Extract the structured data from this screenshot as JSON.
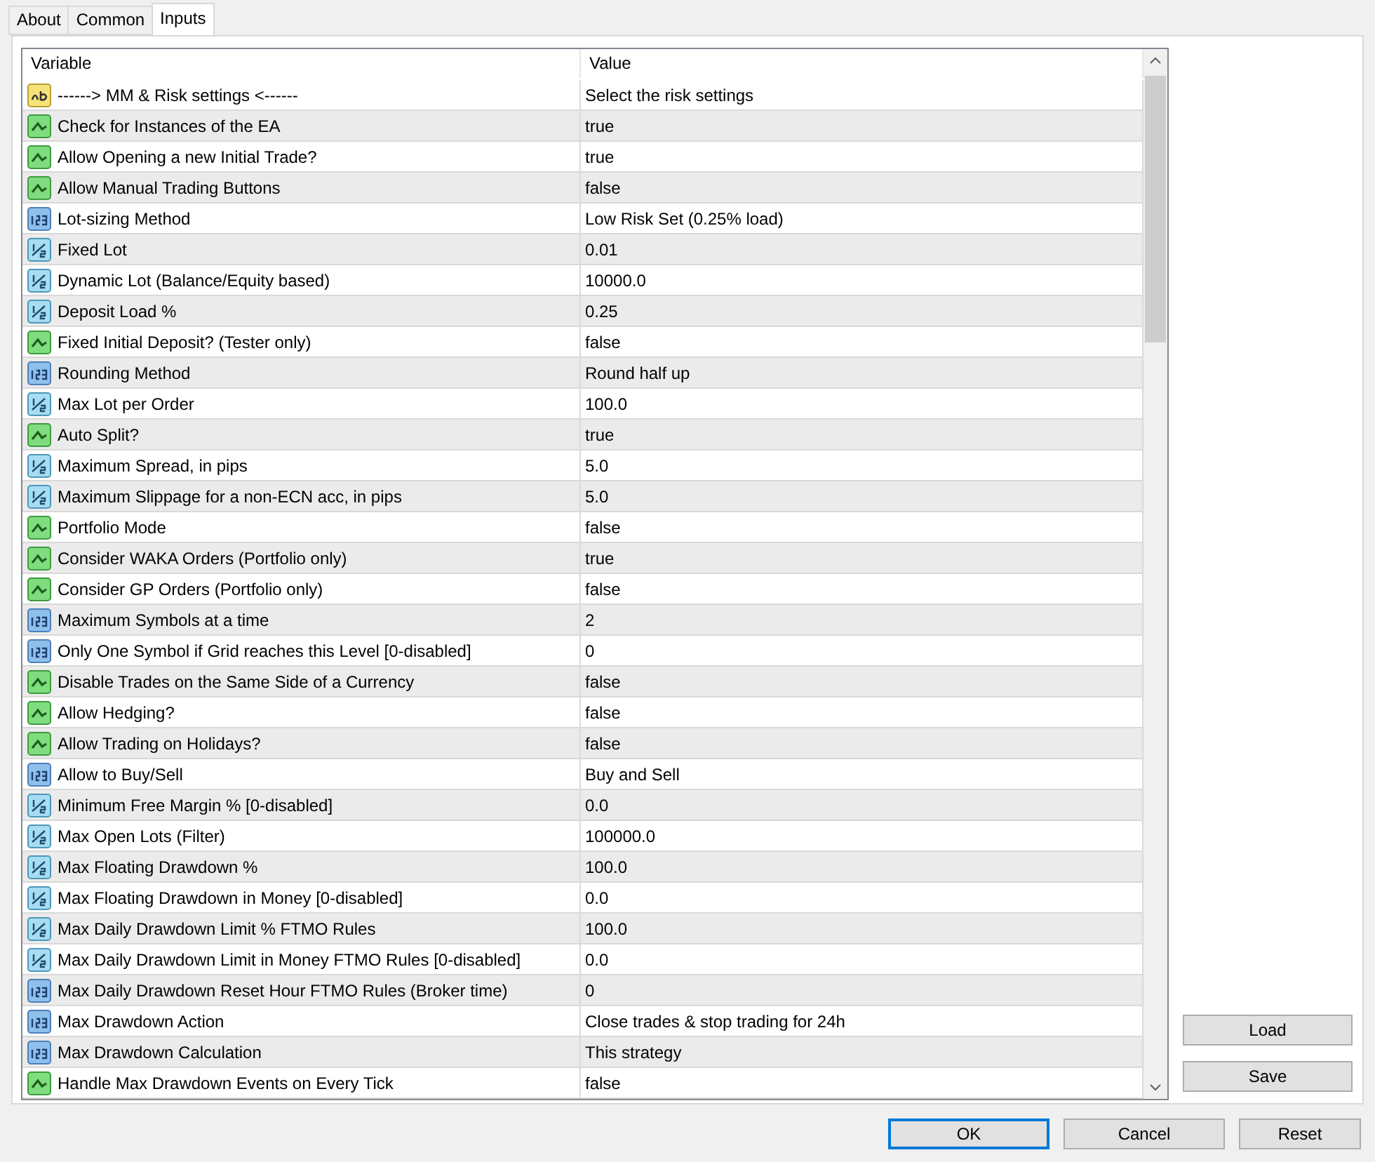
{
  "tabs": [
    {
      "label": "About",
      "selected": false
    },
    {
      "label": "Common",
      "selected": false
    },
    {
      "label": "Inputs",
      "selected": true
    }
  ],
  "table": {
    "columns": [
      "Variable",
      "Value"
    ],
    "rows": [
      {
        "kind": "string",
        "variable": "------> MM & Risk settings <------",
        "value": "Select the risk settings"
      },
      {
        "kind": "bool",
        "variable": "Check for Instances of the EA",
        "value": "true"
      },
      {
        "kind": "bool",
        "variable": "Allow Opening a new Initial Trade?",
        "value": "true"
      },
      {
        "kind": "bool",
        "variable": "Allow Manual Trading Buttons",
        "value": "false"
      },
      {
        "kind": "int",
        "variable": "Lot-sizing Method",
        "value": "Low Risk Set (0.25% load)"
      },
      {
        "kind": "double",
        "variable": "Fixed Lot",
        "value": "0.01"
      },
      {
        "kind": "double",
        "variable": "Dynamic Lot (Balance/Equity based)",
        "value": "10000.0"
      },
      {
        "kind": "double",
        "variable": "Deposit Load %",
        "value": "0.25"
      },
      {
        "kind": "bool",
        "variable": "Fixed Initial Deposit? (Tester only)",
        "value": "false"
      },
      {
        "kind": "int",
        "variable": "Rounding Method",
        "value": "Round half up"
      },
      {
        "kind": "double",
        "variable": "Max Lot per Order",
        "value": "100.0"
      },
      {
        "kind": "bool",
        "variable": "Auto Split?",
        "value": "true"
      },
      {
        "kind": "double",
        "variable": "Maximum Spread, in pips",
        "value": "5.0"
      },
      {
        "kind": "double",
        "variable": "Maximum Slippage for a non-ECN acc, in pips",
        "value": "5.0"
      },
      {
        "kind": "bool",
        "variable": "Portfolio Mode",
        "value": "false"
      },
      {
        "kind": "bool",
        "variable": "Consider WAKA Orders (Portfolio only)",
        "value": "true"
      },
      {
        "kind": "bool",
        "variable": "Consider GP Orders (Portfolio only)",
        "value": "false"
      },
      {
        "kind": "int",
        "variable": "Maximum Symbols at a time",
        "value": "2"
      },
      {
        "kind": "int",
        "variable": "Only One Symbol if Grid reaches this Level [0-disabled]",
        "value": "0"
      },
      {
        "kind": "bool",
        "variable": "Disable Trades on the Same Side of a Currency",
        "value": "false"
      },
      {
        "kind": "bool",
        "variable": "Allow Hedging?",
        "value": "false"
      },
      {
        "kind": "bool",
        "variable": "Allow Trading on Holidays?",
        "value": "false"
      },
      {
        "kind": "int",
        "variable": "Allow to Buy/Sell",
        "value": "Buy and Sell"
      },
      {
        "kind": "double",
        "variable": "Minimum Free Margin % [0-disabled]",
        "value": "0.0"
      },
      {
        "kind": "double",
        "variable": "Max Open Lots (Filter)",
        "value": "100000.0"
      },
      {
        "kind": "double",
        "variable": "Max Floating Drawdown %",
        "value": "100.0"
      },
      {
        "kind": "double",
        "variable": "Max Floating Drawdown in Money [0-disabled]",
        "value": "0.0"
      },
      {
        "kind": "double",
        "variable": "Max Daily Drawdown Limit % FTMO Rules",
        "value": "100.0"
      },
      {
        "kind": "double",
        "variable": "Max Daily Drawdown Limit in Money FTMO Rules [0-disabled]",
        "value": "0.0"
      },
      {
        "kind": "int",
        "variable": "Max Daily Drawdown Reset Hour FTMO Rules (Broker time)",
        "value": "0"
      },
      {
        "kind": "int",
        "variable": "Max Drawdown Action",
        "value": "Close trades & stop trading for 24h"
      },
      {
        "kind": "int",
        "variable": "Max Drawdown Calculation",
        "value": "This strategy"
      },
      {
        "kind": "bool",
        "variable": "Handle Max Drawdown Events on Every Tick",
        "value": "false"
      }
    ]
  },
  "side_buttons": [
    "Load",
    "Save"
  ],
  "buttons": [
    {
      "label": "OK",
      "default": true
    },
    {
      "label": "Cancel",
      "default": false
    },
    {
      "label": "Reset",
      "default": false
    }
  ]
}
